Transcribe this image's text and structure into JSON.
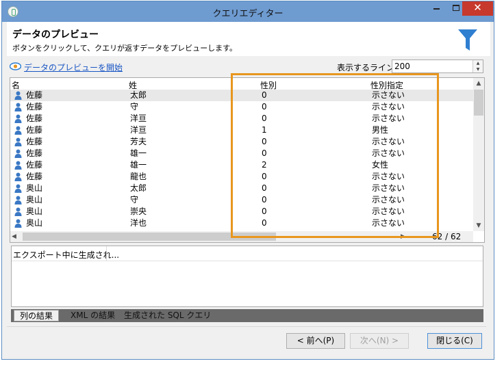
{
  "window": {
    "title": "クエリエディター",
    "close_glyph": "✕"
  },
  "header": {
    "title": "データのプレビュー",
    "subtitle": "ボタンをクリックして、クエリが返すデータをプレビューします。",
    "icon": "filter-icon",
    "icon_color": "#2f7fd1"
  },
  "preview": {
    "link_label": "データのプレビューを開始",
    "lines_label": "表示するライン:",
    "lines_value": "200"
  },
  "grid": {
    "columns": [
      "名",
      "姓",
      "性別",
      "性別指定"
    ],
    "rows": [
      {
        "first": "佐藤",
        "last": "太郎",
        "gender": "0",
        "gender_label": "示さない"
      },
      {
        "first": "佐藤",
        "last": "守",
        "gender": "0",
        "gender_label": "示さない"
      },
      {
        "first": "佐藤",
        "last": "洋亘",
        "gender": "0",
        "gender_label": "示さない"
      },
      {
        "first": "佐藤",
        "last": "洋亘",
        "gender": "1",
        "gender_label": "男性"
      },
      {
        "first": "佐藤",
        "last": "芳夫",
        "gender": "0",
        "gender_label": "示さない"
      },
      {
        "first": "佐藤",
        "last": "雄一",
        "gender": "0",
        "gender_label": "示さない"
      },
      {
        "first": "佐藤",
        "last": "雄一",
        "gender": "2",
        "gender_label": "女性"
      },
      {
        "first": "佐藤",
        "last": "龍也",
        "gender": "0",
        "gender_label": "示さない"
      },
      {
        "first": "奥山",
        "last": "太郎",
        "gender": "0",
        "gender_label": "示さない"
      },
      {
        "first": "奥山",
        "last": "守",
        "gender": "0",
        "gender_label": "示さない"
      },
      {
        "first": "奥山",
        "last": "崇央",
        "gender": "0",
        "gender_label": "示さない"
      },
      {
        "first": "奥山",
        "last": "洋也",
        "gender": "0",
        "gender_label": "示さない"
      }
    ],
    "count": "62 / 62",
    "highlight_color": "#e8961e"
  },
  "export": {
    "text": "エクスポート中に生成され..."
  },
  "tabs": [
    {
      "label": "列の結果"
    },
    {
      "label": "XML の結果"
    },
    {
      "label": "生成された SQL クエリ"
    }
  ],
  "buttons": {
    "prev": "< 前へ(P)",
    "next": "次へ(N) >",
    "close": "閉じる(C)"
  }
}
